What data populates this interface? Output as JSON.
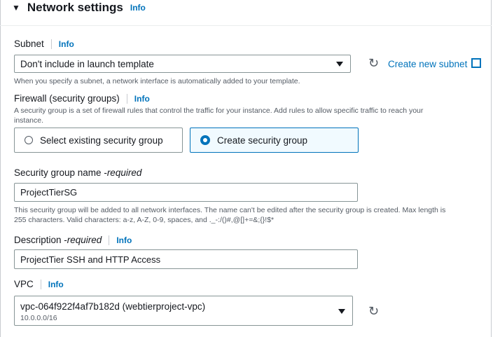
{
  "section": {
    "title": "Network settings",
    "info": "Info"
  },
  "subnet": {
    "label": "Subnet",
    "info": "Info",
    "value": "Don't include in launch template",
    "create_link": "Create new subnet",
    "help": "When you specify a subnet, a network interface is automatically added to your template."
  },
  "firewall": {
    "label": "Firewall (security groups)",
    "info": "Info",
    "help_line1": "A security group is a set of firewall rules that control the traffic for your instance. Add rules to allow specific traffic to reach your",
    "help_line2": "instance.",
    "option_existing": "Select existing security group",
    "option_create": "Create security group",
    "selected": "Create security group"
  },
  "sg_name": {
    "label": "Security group name - ",
    "required": "required",
    "value": "ProjectTierSG",
    "help_line1": "This security group will be added to all network interfaces. The name can't be edited after the security group is created. Max length is",
    "help_line2": "255 characters. Valid characters: a-z, A-Z, 0-9, spaces, and ._-:/()#,@[]+=&;{}!$*"
  },
  "description": {
    "label": "Description - ",
    "required": "required",
    "info": "Info",
    "value": "ProjectTier SSH and HTTP Access"
  },
  "vpc": {
    "label": "VPC",
    "info": "Info",
    "value": "vpc-064f922f4af7b182d (webtierproject-vpc)",
    "cidr": "10.0.0.0/16"
  }
}
